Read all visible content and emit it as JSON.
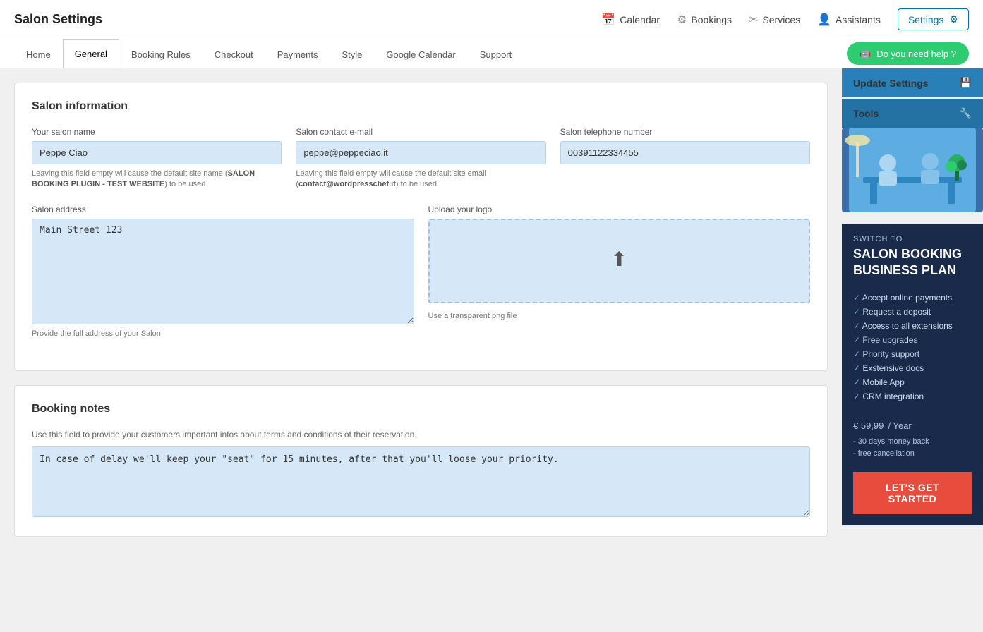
{
  "header": {
    "title": "Salon Settings",
    "nav": [
      {
        "id": "calendar",
        "label": "Calendar",
        "icon": "📅"
      },
      {
        "id": "bookings",
        "label": "Bookings",
        "icon": "⚙"
      },
      {
        "id": "services",
        "label": "Services",
        "icon": "✂"
      },
      {
        "id": "assistants",
        "label": "Assistants",
        "icon": "👤"
      }
    ],
    "settings_label": "Settings",
    "help_label": "Do you need help ?"
  },
  "tabs": [
    {
      "id": "home",
      "label": "Home",
      "active": false
    },
    {
      "id": "general",
      "label": "General",
      "active": true
    },
    {
      "id": "booking-rules",
      "label": "Booking Rules",
      "active": false
    },
    {
      "id": "checkout",
      "label": "Checkout",
      "active": false
    },
    {
      "id": "payments",
      "label": "Payments",
      "active": false
    },
    {
      "id": "style",
      "label": "Style",
      "active": false
    },
    {
      "id": "google-calendar",
      "label": "Google Calendar",
      "active": false
    },
    {
      "id": "support",
      "label": "Support",
      "active": false
    }
  ],
  "salon_info": {
    "title": "Salon information",
    "name_label": "Your salon name",
    "name_value": "Peppe Ciao",
    "name_hint": "Leaving this field empty will cause the default site name (SALON BOOKING PLUGIN - TEST WEBSITE) to be used",
    "email_label": "Salon contact e-mail",
    "email_value": "peppe@peppeciao.it",
    "email_hint": "Leaving this field empty will cause the default site email (contact@wordpresschef.it) to be used",
    "phone_label": "Salon telephone number",
    "phone_value": "00391122334455",
    "address_label": "Salon address",
    "address_value": "Main Street 123",
    "address_hint": "Provide the full address of your Salon",
    "logo_label": "Upload your logo",
    "logo_hint": "Use a transparent png file"
  },
  "booking_notes": {
    "title": "Booking notes",
    "hint": "Use this field to provide your customers important infos about terms and conditions of their reservation.",
    "value": "In case of delay we'll keep your \"seat\" for 15 minutes, after that you'll loose your priority."
  },
  "sidebar": {
    "update_label": "Update Settings",
    "tools_label": "Tools",
    "promo": {
      "switch_label": "SWITCH TO",
      "title": "SALON BOOKING BUSINESS PLAN",
      "features": [
        "Accept online payments",
        "Request a deposit",
        "Access to all extensions",
        "Free upgrades",
        "Priority support",
        "Exstensive docs",
        "Mobile App",
        "CRM integration"
      ],
      "price": "€ 59,99",
      "price_period": "/ Year",
      "notes": "- 30 days money back\n- free cancellation",
      "cta_label": "LET'S GET STARTED"
    }
  }
}
